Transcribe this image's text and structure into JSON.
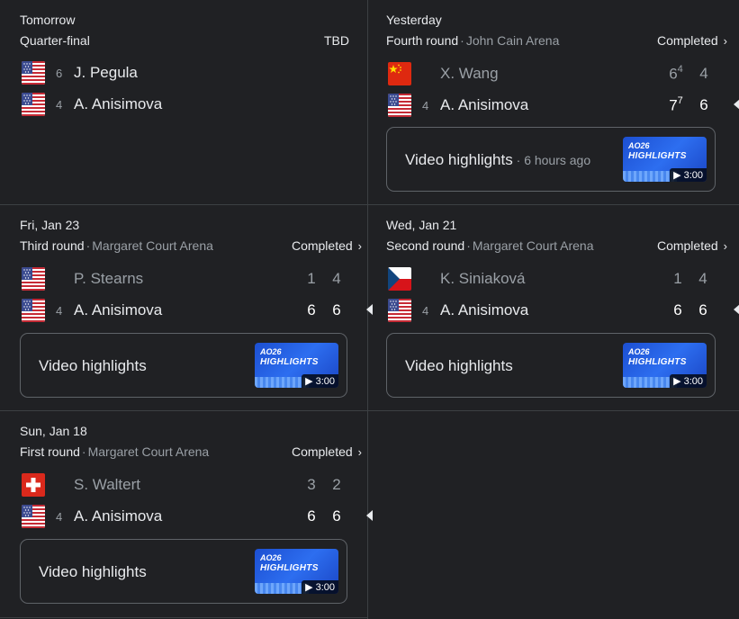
{
  "matches": [
    {
      "date": "Tomorrow",
      "round": "Quarter-final",
      "status": "TBD",
      "players": [
        {
          "flag": "us-flag-icon",
          "seed": "6",
          "name": "J. Pegula"
        },
        {
          "flag": "us-flag-icon",
          "seed": "4",
          "name": "A. Anisimova"
        }
      ]
    },
    {
      "date": "Yesterday",
      "round": "Fourth round",
      "venue": "John Cain Arena",
      "status": "Completed",
      "players": [
        {
          "flag": "china-flag-icon",
          "seed": "",
          "name": "X. Wang",
          "set1": "6",
          "set1_tb": "4",
          "set2": "4"
        },
        {
          "flag": "us-flag-icon",
          "seed": "4",
          "name": "A. Anisimova",
          "set1": "7",
          "set1_tb": "7",
          "set2": "6"
        }
      ],
      "video": {
        "label": "Video highlights",
        "ago": "6 hours ago",
        "thumb_line1": "AO26",
        "thumb_line2": "HIGHLIGHTS",
        "duration": "3:00"
      }
    },
    {
      "date": "Fri, Jan 23",
      "round": "Third round",
      "venue": "Margaret Court Arena",
      "status": "Completed",
      "players": [
        {
          "flag": "us-flag-icon",
          "seed": "",
          "name": "P. Stearns",
          "set1": "1",
          "set2": "4"
        },
        {
          "flag": "us-flag-icon",
          "seed": "4",
          "name": "A. Anisimova",
          "set1": "6",
          "set2": "6"
        }
      ],
      "video": {
        "label": "Video highlights",
        "thumb_line1": "AO26",
        "thumb_line2": "HIGHLIGHTS",
        "duration": "3:00"
      }
    },
    {
      "date": "Wed, Jan 21",
      "round": "Second round",
      "venue": "Margaret Court Arena",
      "status": "Completed",
      "players": [
        {
          "flag": "czech-flag-icon",
          "seed": "",
          "name": "K. Siniaková",
          "set1": "1",
          "set2": "4"
        },
        {
          "flag": "us-flag-icon",
          "seed": "4",
          "name": "A. Anisimova",
          "set1": "6",
          "set2": "6"
        }
      ],
      "video": {
        "label": "Video highlights",
        "thumb_line1": "AO26",
        "thumb_line2": "HIGHLIGHTS",
        "duration": "3:00"
      }
    },
    {
      "date": "Sun, Jan 18",
      "round": "First round",
      "venue": "Margaret Court Arena",
      "status": "Completed",
      "players": [
        {
          "flag": "swiss-flag-icon",
          "seed": "",
          "name": "S. Waltert",
          "set1": "3",
          "set2": "2"
        },
        {
          "flag": "us-flag-icon",
          "seed": "4",
          "name": "A. Anisimova",
          "set1": "6",
          "set2": "6"
        }
      ],
      "video": {
        "label": "Video highlights",
        "thumb_line1": "AO26",
        "thumb_line2": "HIGHLIGHTS",
        "duration": "3:00"
      }
    }
  ],
  "separator": "·",
  "chevron": "›"
}
